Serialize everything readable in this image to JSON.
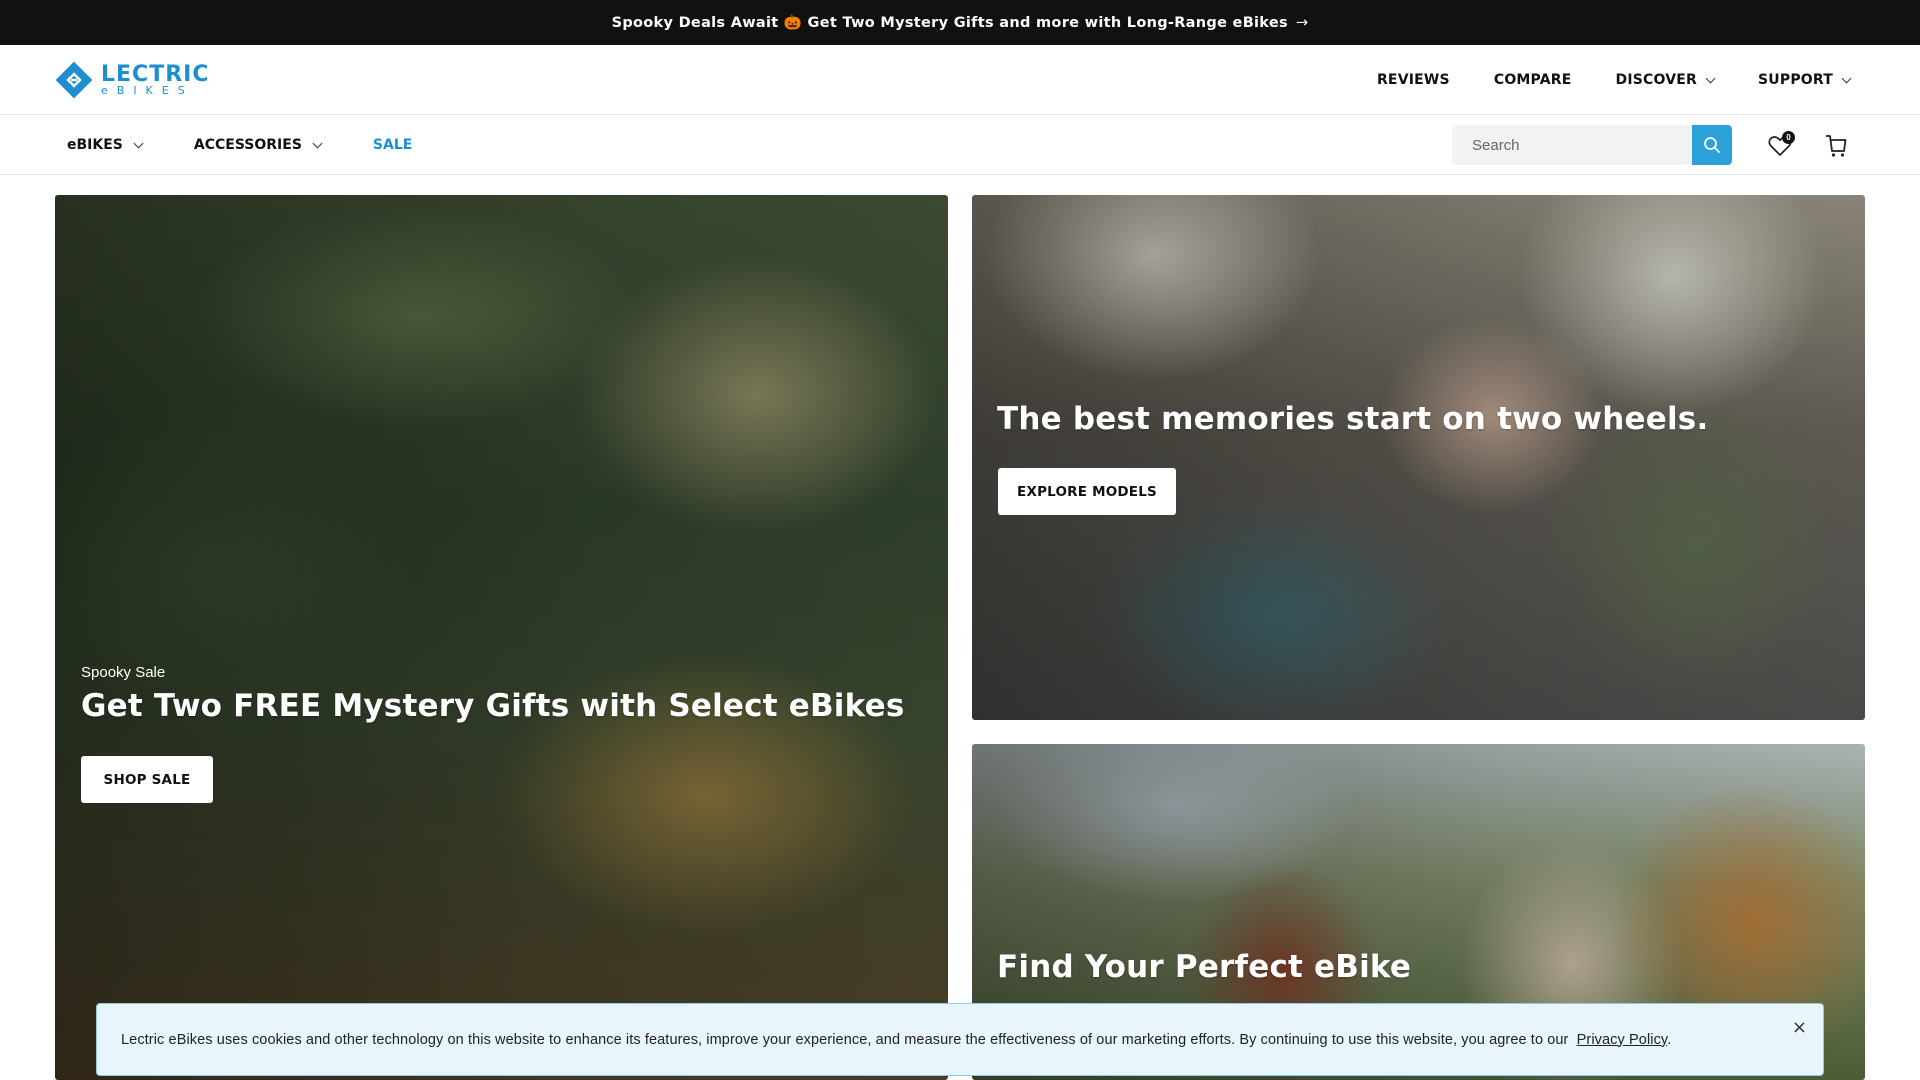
{
  "announcement": {
    "text": "Spooky Deals Await 🎃 Get Two Mystery Gifts and more with Long-Range eBikes",
    "arrow": "→"
  },
  "logo": {
    "main": "LECTRIC",
    "sub": "eBIKES"
  },
  "top_nav": [
    {
      "label": "REVIEWS"
    },
    {
      "label": "COMPARE"
    },
    {
      "label": "DISCOVER"
    },
    {
      "label": "SUPPORT"
    }
  ],
  "sub_nav": [
    {
      "label": "eBIKES"
    },
    {
      "label": "ACCESSORIES"
    },
    {
      "label": "SALE"
    }
  ],
  "search": {
    "placeholder": "Search"
  },
  "wishlist": {
    "count": "0"
  },
  "hero_left": {
    "eyebrow": "Spooky Sale",
    "headline": "Get Two FREE Mystery Gifts with Select eBikes",
    "cta": "SHOP SALE"
  },
  "hero_right_top": {
    "headline": "The best memories start on two wheels.",
    "cta": "EXPLORE MODELS"
  },
  "hero_right_bottom": {
    "headline": "Find Your Perfect eBike"
  },
  "cookie": {
    "text": "Lectric eBikes uses cookies and other technology on this website to enhance its features, improve your experience, and measure the effectiveness of our marketing efforts. By continuing to use this website, you agree to our",
    "link": "Privacy Policy",
    "close": "×"
  },
  "colors": {
    "brand": "#1b8fd0",
    "search_button": "#2aa1d8",
    "announcement_bg": "#111111",
    "cookie_bg": "#e8f5fb"
  }
}
